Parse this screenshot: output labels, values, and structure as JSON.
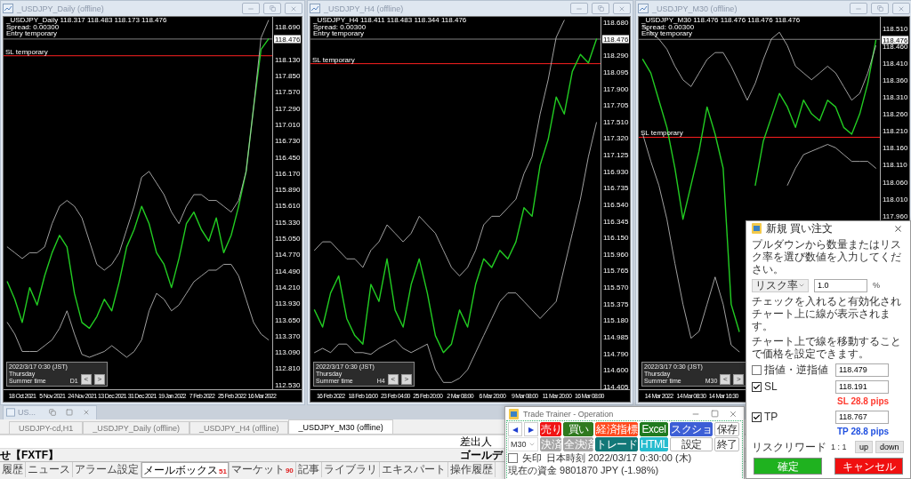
{
  "charts": [
    {
      "title": "_USDJPY_Daily (offline)",
      "info": [
        "_USDJPY_Daily 118.317 118.483 118.173 118.476",
        "Spread: 0.00300",
        "Entry temporary"
      ],
      "last_price": "118.476",
      "info_box": {
        "lines": [
          "2022/3/17 0:30 (JST)",
          "Thursday",
          "Summer time"
        ],
        "period": "D1",
        "prev": "<",
        "next": ">"
      },
      "chart_data": {
        "type": "line",
        "categories": [
          null,
          null,
          "18 Oct 2021",
          null,
          null,
          null,
          "5 Nov 2021",
          null,
          null,
          null,
          "24 Nov 2021",
          null,
          null,
          null,
          "13 Dec 2021",
          null,
          null,
          null,
          "31 Dec 2021",
          null,
          null,
          null,
          "19 Jan 2022",
          null,
          null,
          null,
          "7 Feb 2022",
          null,
          null,
          null,
          "25 Feb 2022",
          null,
          null,
          null,
          "16 Mar 2022",
          null
        ],
        "ylim": [
          112.45,
          118.86
        ],
        "yticks": [
          {
            "value": 118.69,
            "label": "118.690"
          },
          {
            "value": 118.13,
            "label": "118.130"
          },
          {
            "value": 117.85,
            "label": "117.850"
          },
          {
            "value": 117.57,
            "label": "117.570"
          },
          {
            "value": 117.29,
            "label": "117.290"
          },
          {
            "value": 117.01,
            "label": "117.010"
          },
          {
            "value": 116.73,
            "label": "116.730"
          },
          {
            "value": 116.45,
            "label": "116.450"
          },
          {
            "value": 116.17,
            "label": "116.170"
          },
          {
            "value": 115.89,
            "label": "115.890"
          },
          {
            "value": 115.61,
            "label": "115.610"
          },
          {
            "value": 115.33,
            "label": "115.330"
          },
          {
            "value": 115.05,
            "label": "115.050"
          },
          {
            "value": 114.77,
            "label": "114.770"
          },
          {
            "value": 114.49,
            "label": "114.490"
          },
          {
            "value": 114.21,
            "label": "114.210"
          },
          {
            "value": 113.93,
            "label": "113.930"
          },
          {
            "value": 113.65,
            "label": "113.650"
          },
          {
            "value": 113.37,
            "label": "113.370"
          },
          {
            "value": 113.09,
            "label": "113.090"
          },
          {
            "value": 112.81,
            "label": "112.810"
          },
          {
            "value": 112.53,
            "label": "112.530"
          }
        ],
        "series": [
          {
            "color": "#22cc22",
            "values": [
              114.3,
              114.0,
              113.6,
              114.2,
              113.9,
              114.4,
              114.8,
              115.1,
              114.9,
              114.1,
              113.6,
              113.5,
              113.7,
              114.0,
              113.8,
              114.3,
              114.9,
              115.2,
              115.6,
              115.3,
              114.8,
              114.6,
              114.2,
              114.7,
              115.3,
              115.5,
              115.2,
              115.0,
              115.4,
              114.8,
              115.1,
              115.6,
              116.2,
              117.3,
              118.3,
              118.48
            ]
          },
          {
            "color": "#c8c8c8",
            "values": [
              114.9,
              114.8,
              114.7,
              114.8,
              114.8,
              114.9,
              115.3,
              115.6,
              115.7,
              115.6,
              115.4,
              115.0,
              114.6,
              114.5,
              114.6,
              114.8,
              115.2,
              115.6,
              116.1,
              116.2,
              116.0,
              115.8,
              115.5,
              115.3,
              115.6,
              115.8,
              115.8,
              115.7,
              115.7,
              115.6,
              115.5,
              115.7,
              116.2,
              117.3,
              118.5,
              118.8
            ]
          },
          {
            "color": "#c8c8c8",
            "values": [
              113.6,
              113.4,
              113.1,
              113.1,
              113.1,
              113.2,
              113.3,
              113.5,
              113.8,
              113.4,
              113.05,
              113.0,
              113.05,
              113.1,
              113.2,
              113.1,
              113.0,
              113.1,
              113.3,
              113.8,
              114.1,
              114.0,
              113.8,
              113.9,
              114.1,
              114.3,
              114.4,
              114.5,
              114.5,
              114.6,
              114.6,
              114.4,
              114.0,
              113.6,
              113.4,
              113.3
            ]
          }
        ],
        "ref_lines": [
          {
            "axis": "y",
            "value": 118.191,
            "label": "SL temporary"
          },
          {
            "axis": "y",
            "value": 118.479
          }
        ]
      }
    },
    {
      "title": "_USDJPY_H4 (offline)",
      "info": [
        "_USDJPY_H4 118.411 118.483 118.344 118.476",
        "Spread: 0.00300",
        "Entry temporary"
      ],
      "last_price": "118.476",
      "info_box": {
        "lines": [
          "2022/3/17 0:30 (JST)",
          "Thursday",
          "Summer time"
        ],
        "period": "H4",
        "prev": "<",
        "next": ">"
      },
      "chart_data": {
        "type": "line",
        "categories": [
          null,
          null,
          "16 Feb 2022",
          null,
          null,
          null,
          "18 Feb 16:00",
          null,
          null,
          null,
          "23 Feb 04:00",
          null,
          null,
          null,
          "25 Feb 20:00",
          null,
          null,
          null,
          "2 Mar 08:00",
          null,
          null,
          null,
          "6 Mar 20:00",
          null,
          null,
          null,
          "9 Mar 08:00",
          null,
          null,
          null,
          "11 Mar 20:00",
          null,
          null,
          null,
          "16 Mar 08:00",
          null
        ],
        "ylim": [
          114.37,
          118.74
        ],
        "yticks": [
          {
            "value": 118.68,
            "label": "118.680"
          },
          {
            "value": 118.29,
            "label": "118.290"
          },
          {
            "value": 118.095,
            "label": "118.095"
          },
          {
            "value": 117.9,
            "label": "117.900"
          },
          {
            "value": 117.705,
            "label": "117.705"
          },
          {
            "value": 117.51,
            "label": "117.510"
          },
          {
            "value": 117.32,
            "label": "117.320"
          },
          {
            "value": 117.125,
            "label": "117.125"
          },
          {
            "value": 116.93,
            "label": "116.930"
          },
          {
            "value": 116.735,
            "label": "116.735"
          },
          {
            "value": 116.54,
            "label": "116.540"
          },
          {
            "value": 116.345,
            "label": "116.345"
          },
          {
            "value": 116.15,
            "label": "116.150"
          },
          {
            "value": 115.96,
            "label": "115.960"
          },
          {
            "value": 115.765,
            "label": "115.765"
          },
          {
            "value": 115.57,
            "label": "115.570"
          },
          {
            "value": 115.375,
            "label": "115.375"
          },
          {
            "value": 115.18,
            "label": "115.180"
          },
          {
            "value": 114.985,
            "label": "114.985"
          },
          {
            "value": 114.79,
            "label": "114.790"
          },
          {
            "value": 114.6,
            "label": "114.600"
          },
          {
            "value": 114.405,
            "label": "114.405"
          }
        ],
        "series": [
          {
            "color": "#22cc22",
            "values": [
              115.3,
              115.1,
              115.5,
              115.7,
              115.2,
              115.0,
              114.9,
              115.6,
              115.4,
              115.9,
              115.3,
              115.1,
              115.6,
              115.9,
              115.5,
              115.0,
              114.8,
              114.9,
              115.3,
              115.1,
              115.6,
              115.9,
              115.8,
              116.0,
              115.9,
              116.1,
              116.5,
              116.4,
              117.0,
              117.3,
              117.8,
              117.6,
              118.1,
              118.3,
              118.2,
              118.48
            ]
          },
          {
            "color": "#c8c8c8",
            "values": [
              116.0,
              116.1,
              116.1,
              116.0,
              115.9,
              115.9,
              115.8,
              116.0,
              116.1,
              116.3,
              116.2,
              116.1,
              116.2,
              116.4,
              116.3,
              116.2,
              116.0,
              115.8,
              115.7,
              115.8,
              116.0,
              116.3,
              116.4,
              116.4,
              116.5,
              116.6,
              116.9,
              117.1,
              117.6,
              118.0,
              118.5,
              118.7,
              null,
              null,
              null,
              null
            ]
          },
          {
            "color": "#c8c8c8",
            "values": [
              114.8,
              114.85,
              114.8,
              114.9,
              114.9,
              114.8,
              114.8,
              114.78,
              114.85,
              114.9,
              114.95,
              114.85,
              114.8,
              114.85,
              114.9,
              114.6,
              114.45,
              114.45,
              114.5,
              114.6,
              114.8,
              115.0,
              115.2,
              115.4,
              115.5,
              115.5,
              115.4,
              115.3,
              115.2,
              115.3,
              115.4,
              115.8,
              116.2,
              116.6,
              117.1,
              117.5
            ]
          }
        ],
        "ref_lines": [
          {
            "axis": "y",
            "value": 118.191,
            "label": "SL temporary"
          },
          {
            "axis": "y",
            "value": 118.479
          }
        ]
      }
    },
    {
      "title": "_USDJPY_M30 (offline)",
      "info": [
        "_USDJPY_M30 118.476 118.476 118.476 118.476",
        "Spread: 0.00300",
        "Entry temporary"
      ],
      "last_price": "118.476",
      "info_box": {
        "lines": [
          "2022/3/17 0:30 (JST)",
          "Thursday",
          "Summer time"
        ],
        "period": "M30",
        "prev": "<",
        "next": ">"
      },
      "chart_data": {
        "type": "line",
        "categories": [
          null,
          null,
          "14 Mar 2022",
          null,
          null,
          null,
          "14 Mar 08:30",
          null,
          null,
          null,
          "14 Mar 16:30",
          null,
          null,
          null,
          null,
          null,
          null,
          null,
          null,
          null,
          null,
          null,
          null,
          null,
          null,
          null,
          null,
          null,
          null,
          null
        ],
        "ylim": [
          117.45,
          118.545
        ],
        "yticks": [
          {
            "value": 118.51,
            "label": "118.510"
          },
          {
            "value": 118.46,
            "label": "118.460"
          },
          {
            "value": 118.41,
            "label": "118.410"
          },
          {
            "value": 118.36,
            "label": "118.360"
          },
          {
            "value": 118.31,
            "label": "118.310"
          },
          {
            "value": 118.26,
            "label": "118.260"
          },
          {
            "value": 118.21,
            "label": "118.210"
          },
          {
            "value": 118.16,
            "label": "118.160"
          },
          {
            "value": 118.11,
            "label": "118.110"
          },
          {
            "value": 118.06,
            "label": "118.060"
          },
          {
            "value": 118.01,
            "label": "118.010"
          },
          {
            "value": 117.96,
            "label": "117.960"
          }
        ],
        "series": [
          {
            "color": "#22cc22",
            "values": [
              118.42,
              118.38,
              118.3,
              118.22,
              118.1,
              117.95,
              118.05,
              118.15,
              118.28,
              118.2,
              118.1,
              117.7,
              117.62,
              null,
              118.05,
              118.18,
              118.25,
              118.32,
              118.28,
              118.22,
              118.3,
              118.26,
              118.24,
              118.3,
              118.28,
              118.22,
              118.2,
              118.26,
              118.35,
              118.476
            ]
          },
          {
            "color": "#c8c8c8",
            "values": [
              118.52,
              118.5,
              118.48,
              118.45,
              118.4,
              118.36,
              118.34,
              118.38,
              118.42,
              118.44,
              118.44,
              118.4,
              118.35,
              118.3,
              118.35,
              118.42,
              118.48,
              118.5,
              118.46,
              118.4,
              118.38,
              118.36,
              118.38,
              118.4,
              118.38,
              118.34,
              118.3,
              118.32,
              118.38,
              118.46
            ]
          },
          {
            "color": "#c8c8c8",
            "values": [
              118.2,
              118.12,
              118.05,
              117.95,
              117.82,
              117.7,
              117.6,
              117.62,
              117.7,
              117.78,
              117.7,
              117.58,
              117.56,
              null,
              null,
              null,
              null,
              null,
              118.05,
              118.1,
              118.14,
              118.15,
              118.16,
              118.17,
              118.16,
              118.14,
              118.12,
              118.12,
              118.12,
              118.1
            ]
          }
        ],
        "ref_lines": [
          {
            "axis": "y",
            "value": 118.191,
            "label": "SL temporary"
          },
          {
            "axis": "y",
            "value": 118.479
          }
        ]
      }
    }
  ],
  "minimized_window": {
    "title": "US..."
  },
  "chart_tabs": [
    {
      "label": "USDJPY-cd,H1",
      "selected": false
    },
    {
      "label": "_USDJPY_Daily (offline)",
      "selected": false
    },
    {
      "label": "_USDJPY_H4 (offline)",
      "selected": false
    },
    {
      "label": "_USDJPY_M30 (offline)",
      "selected": true
    }
  ],
  "terminal": {
    "columns": [
      "",
      "差出人"
    ],
    "rows": [
      [
        "せ【FXTF】",
        "ゴールデ"
      ]
    ],
    "tabs": [
      {
        "label": "履歴",
        "selected": false
      },
      {
        "label": "ニュース",
        "selected": false
      },
      {
        "label": "アラーム設定",
        "selected": false
      },
      {
        "label": "メールボックス",
        "badge": "51",
        "selected": true
      },
      {
        "label": "マーケット",
        "badge": "90",
        "selected": false
      },
      {
        "label": "記事",
        "selected": false
      },
      {
        "label": "ライブラリ",
        "selected": false
      },
      {
        "label": "エキスパート",
        "selected": false
      },
      {
        "label": "操作履歴",
        "selected": false
      }
    ]
  },
  "trade_trainer": {
    "title": "Trade Trainer - Operation",
    "period": "M30",
    "buttons": [
      {
        "kind": "arrow",
        "label": "◀"
      },
      {
        "kind": "arrow",
        "label": "▶"
      },
      {
        "kind": "action",
        "label": "売り",
        "color": "#f01414"
      },
      {
        "kind": "action",
        "label": "買い",
        "color": "#2f7a1f"
      },
      {
        "kind": "action",
        "label": "経済指標",
        "color": "#ff4b1f"
      },
      {
        "kind": "action",
        "label": "Excel",
        "color": "#1f7a1f"
      },
      {
        "kind": "action",
        "label": "スクショ",
        "color": "#3d5fd6"
      },
      {
        "kind": "action",
        "label": "保存",
        "color": "#ffffff"
      },
      {
        "kind": "select"
      },
      {
        "kind": "action",
        "label": "決済",
        "color": "#a6a6a6"
      },
      {
        "kind": "action",
        "label": "全決済",
        "color": "#a6a6a6"
      },
      {
        "kind": "action",
        "label": "トレード",
        "color": "#127878"
      },
      {
        "kind": "action",
        "label": "HTML",
        "color": "#27bccf"
      },
      {
        "kind": "action",
        "label": "設定",
        "color": "#ffffff"
      },
      {
        "kind": "action",
        "label": "終了",
        "color": "#ffffff"
      }
    ],
    "arrow_toggle": {
      "label": "矢印",
      "checked": false
    },
    "clock": "日本時刻 2022/03/17 0:30:00 (木)",
    "funds": "現在の資金 9801870 JPY (-1.98%)"
  },
  "order_dialog": {
    "title": "新規 買い注文",
    "instruction": "プルダウンから数量またはリスク率を選び数値を入力してください。",
    "mode": "リスク率",
    "amount": "1.0",
    "unit": "%",
    "notes": [
      "チェックを入れると有効化されチャート上に線が表示されます。",
      "チャート上で線を移動することで価格を設定できます。"
    ],
    "levels": [
      {
        "label": "指値・逆指値",
        "checked": false,
        "value": "118.479"
      },
      {
        "label": "SL",
        "checked": true,
        "value": "118.191",
        "pips": "SL 28.8 pips",
        "color": "#ff3b30"
      },
      {
        "label": "TP",
        "checked": true,
        "value": "118.767",
        "pips": "TP 28.8 pips",
        "color": "#2050e0"
      }
    ],
    "risk_reward_label": "リスクリワード",
    "risk_reward": "1 : 1",
    "up": "up",
    "down": "down",
    "confirm": "確定",
    "cancel": "キャンセル"
  }
}
